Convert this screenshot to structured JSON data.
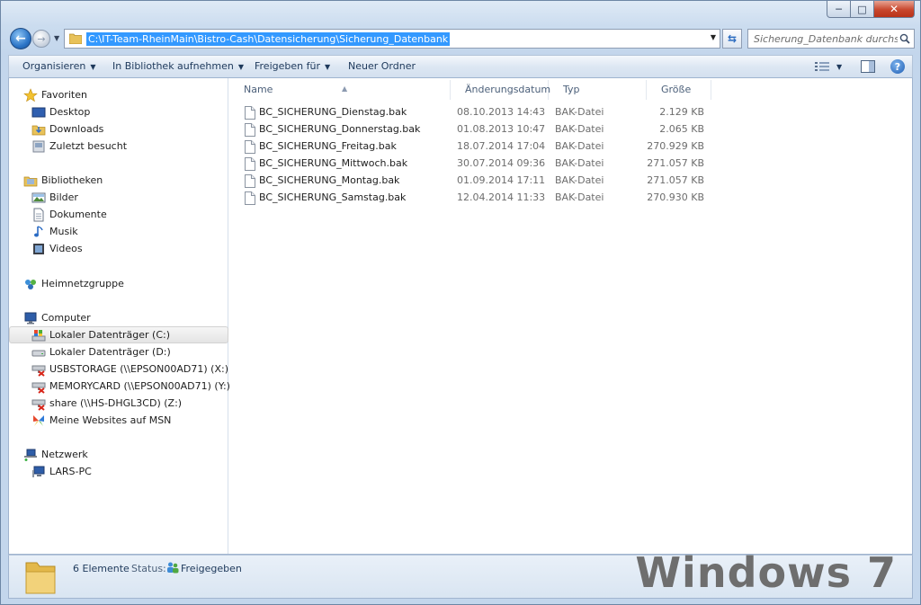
{
  "window": {
    "caption": {
      "minimize": "─",
      "maximize": "□",
      "close": "✕"
    }
  },
  "address": {
    "path": "C:\\IT-Team-RheinMain\\Bistro-Cash\\Datensicherung\\Sicherung_Datenbank",
    "search_placeholder": "Sicherung_Datenbank durchsuc..."
  },
  "toolbar": {
    "organize": "Organisieren",
    "include_library": "In Bibliothek aufnehmen",
    "share_with": "Freigeben für",
    "new_folder": "Neuer Ordner"
  },
  "nav": {
    "favorites": {
      "label": "Favoriten",
      "items": [
        "Desktop",
        "Downloads",
        "Zuletzt besucht"
      ]
    },
    "libraries": {
      "label": "Bibliotheken",
      "items": [
        "Bilder",
        "Dokumente",
        "Musik",
        "Videos"
      ]
    },
    "homegroup": "Heimnetzgruppe",
    "computer": {
      "label": "Computer",
      "items": [
        "Lokaler Datenträger (C:)",
        "Lokaler Datenträger (D:)",
        "USBSTORAGE (\\\\EPSON00AD71) (X:)",
        "MEMORYCARD (\\\\EPSON00AD71) (Y:)",
        "share (\\\\HS-DHGL3CD) (Z:)",
        "Meine Websites auf MSN"
      ]
    },
    "network": {
      "label": "Netzwerk",
      "items": [
        "LARS-PC"
      ]
    }
  },
  "columns": {
    "name": "Name",
    "date": "Änderungsdatum",
    "type": "Typ",
    "size": "Größe"
  },
  "files": [
    {
      "name": "BC_SICHERUNG_Dienstag.bak",
      "date": "08.10.2013 14:43",
      "type": "BAK-Datei",
      "size": "2.129 KB"
    },
    {
      "name": "BC_SICHERUNG_Donnerstag.bak",
      "date": "01.08.2013 10:47",
      "type": "BAK-Datei",
      "size": "2.065 KB"
    },
    {
      "name": "BC_SICHERUNG_Freitag.bak",
      "date": "18.07.2014 17:04",
      "type": "BAK-Datei",
      "size": "270.929 KB"
    },
    {
      "name": "BC_SICHERUNG_Mittwoch.bak",
      "date": "30.07.2014 09:36",
      "type": "BAK-Datei",
      "size": "271.057 KB"
    },
    {
      "name": "BC_SICHERUNG_Montag.bak",
      "date": "01.09.2014 17:11",
      "type": "BAK-Datei",
      "size": "271.057 KB"
    },
    {
      "name": "BC_SICHERUNG_Samstag.bak",
      "date": "12.04.2014 11:33",
      "type": "BAK-Datei",
      "size": "270.930 KB"
    }
  ],
  "details": {
    "count": "6 Elemente",
    "status_label": "Status:",
    "status_value": "Freigegeben"
  },
  "watermark": "Windows 7"
}
